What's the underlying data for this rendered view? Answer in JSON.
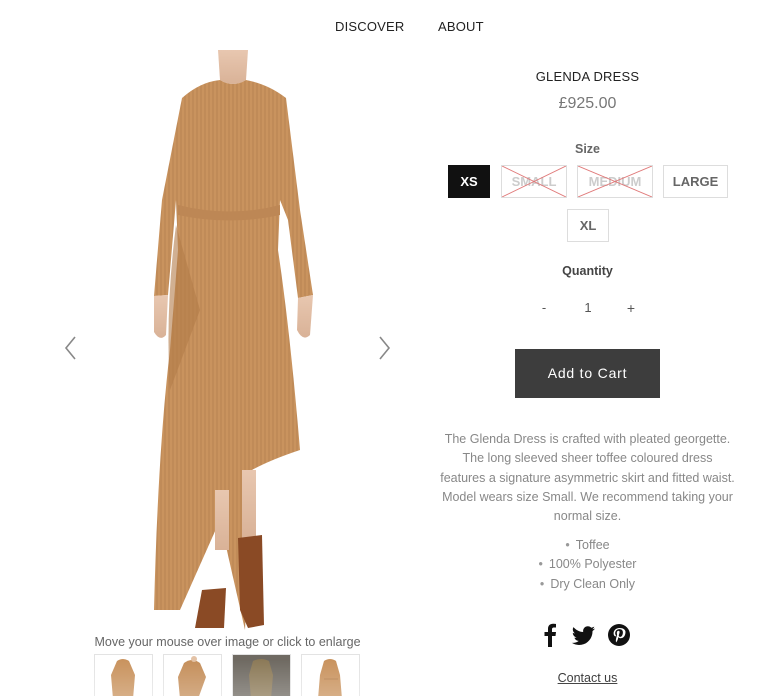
{
  "nav": {
    "items": [
      {
        "label": "DISCOVER"
      },
      {
        "label": "ABOUT"
      }
    ]
  },
  "gallery": {
    "main_image_icon": "dress-photo",
    "prev_icon": "chevron-left-icon",
    "next_icon": "chevron-right-icon",
    "zoom_hint": "Move your mouse over image or click to enlarge",
    "thumbnails": [
      {
        "icon": "dress-thumbnail"
      },
      {
        "icon": "dress-thumbnail"
      },
      {
        "icon": "dress-thumbnail"
      },
      {
        "icon": "dress-thumbnail"
      }
    ]
  },
  "product": {
    "title": "GLENDA DRESS",
    "price": "£925.00",
    "size_label": "Size",
    "sizes": [
      {
        "label": "XS",
        "state": "selected"
      },
      {
        "label": "SMALL",
        "state": "sold-out"
      },
      {
        "label": "MEDIUM",
        "state": "sold-out"
      },
      {
        "label": "LARGE",
        "state": "available"
      },
      {
        "label": "XL",
        "state": "available"
      }
    ],
    "quantity_label": "Quantity",
    "quantity": {
      "minus": "-",
      "value": "1",
      "plus": "+"
    },
    "add_to_cart": "Add to Cart",
    "description": "The Glenda Dress is crafted with pleated georgette. The long sleeved sheer toffee coloured dress features a signature asymmetric skirt and fitted waist.  Model wears size Small. We recommend taking your normal size.",
    "features": [
      "Toffee",
      "100% Polyester",
      "Dry Clean Only"
    ],
    "social_icons": [
      "facebook-icon",
      "twitter-icon",
      "pinterest-icon"
    ],
    "contact": "Contact us"
  },
  "colors": {
    "dress": "#c9935e",
    "cart_button": "#3d3d3d",
    "selected_size": "#111111",
    "sold_out_cross": "#e07a7a"
  }
}
